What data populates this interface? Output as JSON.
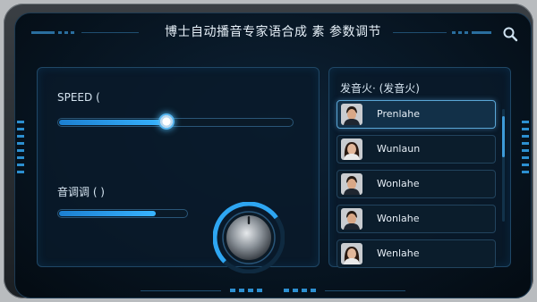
{
  "header": {
    "title": "博士自动播音专家语合成 素 参数调节",
    "search_icon": "search-icon"
  },
  "speed": {
    "label": "SPEED (",
    "value_pct": 46
  },
  "tone": {
    "label": "音调调 ( )",
    "value_pct": 75
  },
  "knob": {
    "level_pct": 70,
    "icon": "volume-knob"
  },
  "voices": {
    "title": "发音火· (发音火)",
    "items": [
      {
        "name": "Prenlahe",
        "gender": "male",
        "selected": true
      },
      {
        "name": "Wunlaun",
        "gender": "female",
        "selected": false
      },
      {
        "name": "Wonlahe",
        "gender": "male",
        "selected": false
      },
      {
        "name": "Wonlahe",
        "gender": "male",
        "selected": false
      },
      {
        "name": "Wenlahe",
        "gender": "female",
        "selected": false
      }
    ]
  },
  "colors": {
    "accent": "#38b4ff",
    "panel_border": "#1f4766",
    "background": "#06121d"
  }
}
